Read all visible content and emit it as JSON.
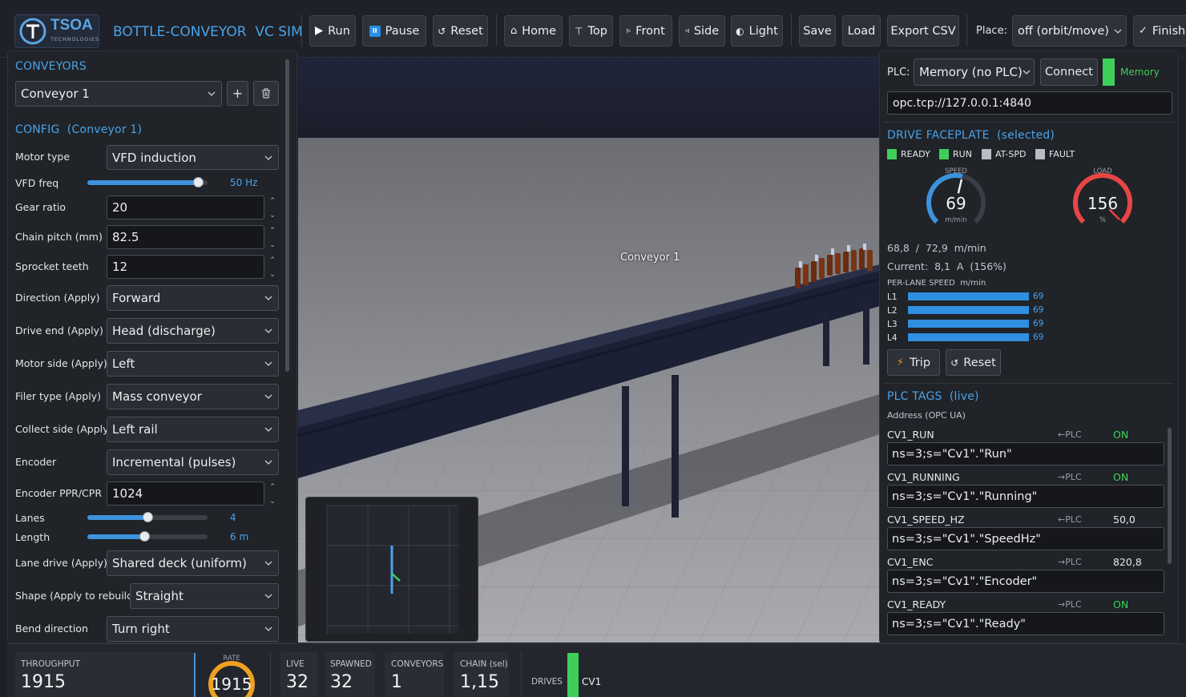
{
  "app": {
    "logo_text": "TSOA",
    "logo_subtext": "TECHNOLOGIES",
    "title": "BOTTLE-CONVEYOR  VC SIM"
  },
  "toolbar": {
    "run": "Run",
    "pause": "Pause",
    "reset": "Reset",
    "home": "Home",
    "top": "Top",
    "front": "Front",
    "side": "Side",
    "light": "Light",
    "save": "Save",
    "load": "Load",
    "export": "Export CSV",
    "place_label": "Place:",
    "place_value": "off (orbit/move)",
    "finish": "Finish"
  },
  "left": {
    "conveyors_header": "CONVEYORS",
    "conveyor_select": "Conveyor 1",
    "config_header": "CONFIG  (Conveyor 1)",
    "fields": {
      "motor_type_label": "Motor type",
      "motor_type_value": "VFD induction",
      "vfd_freq_label": "VFD freq",
      "vfd_freq_value": "50 Hz",
      "vfd_freq_fraction": 0.92,
      "gear_ratio_label": "Gear ratio",
      "gear_ratio_value": "20",
      "chain_pitch_label": "Chain pitch (mm)",
      "chain_pitch_value": "82.5",
      "sprocket_label": "Sprocket teeth",
      "sprocket_value": "12",
      "direction_label": "Direction (Apply)",
      "direction_value": "Forward",
      "drive_end_label": "Drive end (Apply)",
      "drive_end_value": "Head (discharge)",
      "motor_side_label": "Motor side (Apply)",
      "motor_side_value": "Left",
      "filer_label": "Filer type (Apply)",
      "filer_value": "Mass conveyor",
      "collect_label": "Collect side (Apply)",
      "collect_value": "Left rail",
      "encoder_label": "Encoder",
      "encoder_value": "Incremental (pulses)",
      "ppr_label": "Encoder PPR/CPR",
      "ppr_value": "1024",
      "lanes_label": "Lanes",
      "lanes_value": "4",
      "lanes_fraction": 0.5,
      "length_label": "Length",
      "length_value": "6 m",
      "length_fraction": 0.47,
      "lane_drive_label": "Lane drive (Apply)",
      "lane_drive_value": "Shared deck (uniform)",
      "shape_label": "Shape (Apply to rebuild)",
      "shape_value": "Straight",
      "bend_label": "Bend direction",
      "bend_value": "Turn right"
    }
  },
  "viewport": {
    "conveyor_label": "Conveyor 1"
  },
  "right": {
    "plc_label": "PLC:",
    "plc_mode": "Memory (no PLC)",
    "connect": "Connect",
    "status": "Memory",
    "endpoint": "opc.tcp://127.0.0.1:4840",
    "faceplate_header": "DRIVE FACEPLATE  (selected)",
    "lamps": [
      {
        "label": "READY",
        "on": true
      },
      {
        "label": "RUN",
        "on": true
      },
      {
        "label": "AT-SPD",
        "on": false
      },
      {
        "label": "FAULT",
        "on": false
      }
    ],
    "speed_gauge": {
      "title": "SPEED",
      "value": "69",
      "unit": "m/min",
      "fraction": 0.55
    },
    "load_gauge": {
      "title": "LOAD",
      "value": "156",
      "unit": "%",
      "fraction": 1.0
    },
    "speed_text": "68,8  /  72,9  m/min",
    "current_text": "Current:  8,1  A  (156%)",
    "lane_header": "PER-LANE SPEED  m/min",
    "lanes": [
      {
        "name": "L1",
        "value": "69"
      },
      {
        "name": "L2",
        "value": "69"
      },
      {
        "name": "L3",
        "value": "69"
      },
      {
        "name": "L4",
        "value": "69"
      }
    ],
    "trip": "Trip",
    "reset": "Reset",
    "tags_header": "PLC TAGS  (live)",
    "address_label": "Address (OPC UA)",
    "tags": [
      {
        "name": "CV1_RUN",
        "dir": "←PLC",
        "value": "ON",
        "address": "ns=3;s=\"Cv1\".\"Run\""
      },
      {
        "name": "CV1_RUNNING",
        "dir": "→PLC",
        "value": "ON",
        "address": "ns=3;s=\"Cv1\".\"Running\""
      },
      {
        "name": "CV1_SPEED_HZ",
        "dir": "←PLC",
        "value": "50,0",
        "address": "ns=3;s=\"Cv1\".\"SpeedHz\""
      },
      {
        "name": "CV1_ENC",
        "dir": "→PLC",
        "value": "820,8",
        "address": "ns=3;s=\"Cv1\".\"Encoder\""
      },
      {
        "name": "CV1_READY",
        "dir": "→PLC",
        "value": "ON",
        "address": "ns=3;s=\"Cv1\".\"Ready\""
      }
    ]
  },
  "bottom": {
    "throughput_label": "THROUGHPUT",
    "throughput_value": "1915",
    "rate_title": "RATE",
    "rate_value": "1915",
    "live_label": "LIVE",
    "live_value": "32",
    "spawned_label": "SPAWNED",
    "spawned_value": "32",
    "conveyors_label": "CONVEYORS",
    "conveyors_value": "1",
    "chain_label": "CHAIN (sel)",
    "chain_value": "1,15",
    "drives_label": "DRIVES",
    "drive_name": "CV1"
  },
  "colors": {
    "accent": "#48a3e8",
    "on": "#3ecf5a",
    "lamp_on": "#3ecf5a",
    "lamp_off": "#b8bcc4",
    "load_red": "#e84545",
    "rate_orange": "#f0a020"
  }
}
